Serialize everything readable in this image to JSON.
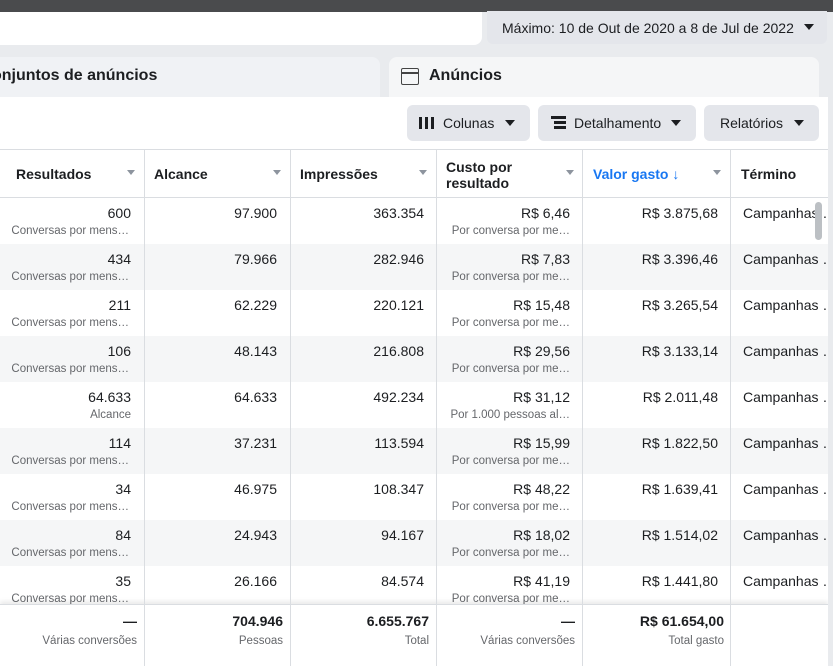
{
  "date_range": {
    "label": "Máximo: 10 de Out de 2020 a 8 de Jul de 2022",
    "icon": "caret-down-icon"
  },
  "tabs": {
    "ad_sets": "onjuntos de anúncios",
    "ads": "Anúncios",
    "ads_icon": "ad-frame-icon"
  },
  "toolbar": {
    "columns": "Colunas",
    "breakdown": "Detalhamento",
    "reports": "Relatórios"
  },
  "columns": {
    "results": "Resultados",
    "reach": "Alcance",
    "impressions": "Impressões",
    "cost_line1": "Custo por",
    "cost_line2": "resultado",
    "spent": "Valor gasto ↓",
    "end": "Término"
  },
  "rows": [
    {
      "results": "600",
      "results_sub": "Conversas por mens…",
      "reach": "97.900",
      "impressions": "363.354",
      "cost": "R$ 6,46",
      "cost_sub": "Por conversa por me…",
      "spent": "R$ 3.875,68",
      "end": "Campanhas …"
    },
    {
      "results": "434",
      "results_sub": "Conversas por mens…",
      "reach": "79.966",
      "impressions": "282.946",
      "cost": "R$ 7,83",
      "cost_sub": "Por conversa por me…",
      "spent": "R$ 3.396,46",
      "end": "Campanhas …"
    },
    {
      "results": "211",
      "results_sub": "Conversas por mens…",
      "reach": "62.229",
      "impressions": "220.121",
      "cost": "R$ 15,48",
      "cost_sub": "Por conversa por me…",
      "spent": "R$ 3.265,54",
      "end": "Campanhas …"
    },
    {
      "results": "106",
      "results_sub": "Conversas por mens…",
      "reach": "48.143",
      "impressions": "216.808",
      "cost": "R$ 29,56",
      "cost_sub": "Por conversa por me…",
      "spent": "R$ 3.133,14",
      "end": "Campanhas …"
    },
    {
      "results": "64.633",
      "results_sub": "Alcance",
      "reach": "64.633",
      "impressions": "492.234",
      "cost": "R$ 31,12",
      "cost_sub": "Por 1.000 pessoas al…",
      "spent": "R$ 2.011,48",
      "end": "Campanhas …"
    },
    {
      "results": "114",
      "results_sub": "Conversas por mens…",
      "reach": "37.231",
      "impressions": "113.594",
      "cost": "R$ 15,99",
      "cost_sub": "Por conversa por me…",
      "spent": "R$ 1.822,50",
      "end": "Campanhas …"
    },
    {
      "results": "34",
      "results_sub": "Conversas por mens…",
      "reach": "46.975",
      "impressions": "108.347",
      "cost": "R$ 48,22",
      "cost_sub": "Por conversa por me…",
      "spent": "R$ 1.639,41",
      "end": "Campanhas …"
    },
    {
      "results": "84",
      "results_sub": "Conversas por mens…",
      "reach": "24.943",
      "impressions": "94.167",
      "cost": "R$ 18,02",
      "cost_sub": "Por conversa por me…",
      "spent": "R$ 1.514,02",
      "end": "Campanhas …"
    },
    {
      "results": "35",
      "results_sub": "Conversas por mens…",
      "reach": "26.166",
      "impressions": "84.574",
      "cost": "R$ 41,19",
      "cost_sub": "Por conversa por me…",
      "spent": "R$ 1.441,80",
      "end": "Campanhas …"
    }
  ],
  "totals": {
    "results": "—",
    "results_sub": "Várias conversões",
    "reach": "704.946",
    "reach_sub": "Pessoas",
    "impressions": "6.655.767",
    "impressions_sub": "Total",
    "cost": "—",
    "cost_sub": "Várias conversões",
    "spent": "R$ 61.654,00",
    "spent_sub": "Total gasto"
  },
  "colors": {
    "active_header": "#1877f2",
    "row_alt": "#f5f6f7",
    "border": "#dadde1"
  }
}
